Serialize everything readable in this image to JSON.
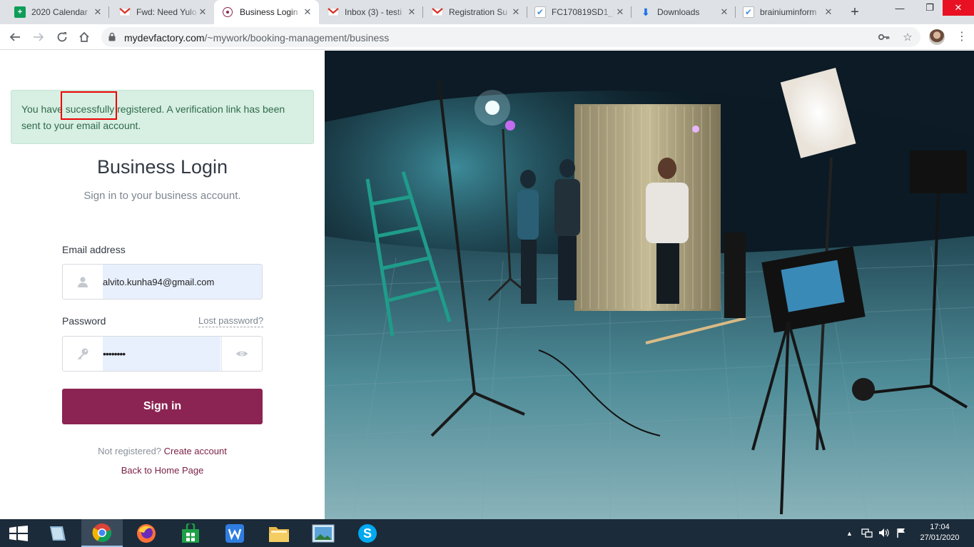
{
  "browser": {
    "tabs": [
      {
        "title": "2020 Calendar",
        "icon": "google-sheets-icon",
        "color": "#0f9d58"
      },
      {
        "title": "Fwd: Need Yulo",
        "icon": "gmail-icon",
        "color": "#d93025"
      },
      {
        "title": "Business Login",
        "icon": "site-favicon",
        "color": "#8b2452",
        "active": true
      },
      {
        "title": "Inbox (3) - testi",
        "icon": "gmail-icon",
        "color": "#d93025"
      },
      {
        "title": "Registration Su",
        "icon": "gmail-icon",
        "color": "#d93025"
      },
      {
        "title": "FC170819SD1_l",
        "icon": "checkmark-doc-icon",
        "color": "#4a90d9"
      },
      {
        "title": "Downloads",
        "icon": "download-icon",
        "color": "#1a73e8"
      },
      {
        "title": "brainiuminform",
        "icon": "checkmark-doc-icon",
        "color": "#4a90d9"
      }
    ],
    "url_host": "mydevfactory.com",
    "url_path": "/~mywork/booking-management/business"
  },
  "alert": {
    "text": "You have sucessfully registered. A verification link has been sent to your email account."
  },
  "login": {
    "title": "Business Login",
    "subtitle": "Sign in to your business account.",
    "email_label": "Email address",
    "email_value": "alvito.kunha94@gmail.com",
    "password_label": "Password",
    "lost_password": "Lost password?",
    "password_value": "••••••••",
    "signin_label": "Sign in",
    "not_registered": "Not registered?",
    "create_account": "Create account",
    "back_home": "Back to Home Page"
  },
  "colors": {
    "brand": "#8b2452",
    "alert_bg": "#d8efe3",
    "alert_text": "#2e6b4a",
    "input_fill": "#e8f0fe"
  },
  "taskbar": {
    "apps": [
      "windows-start-icon",
      "file-manager-icon",
      "chrome-icon",
      "firefox-icon",
      "store-icon",
      "wps-writer-icon",
      "folder-icon",
      "photos-icon",
      "skype-icon"
    ],
    "time": "17:04",
    "date": "27/01/2020"
  }
}
